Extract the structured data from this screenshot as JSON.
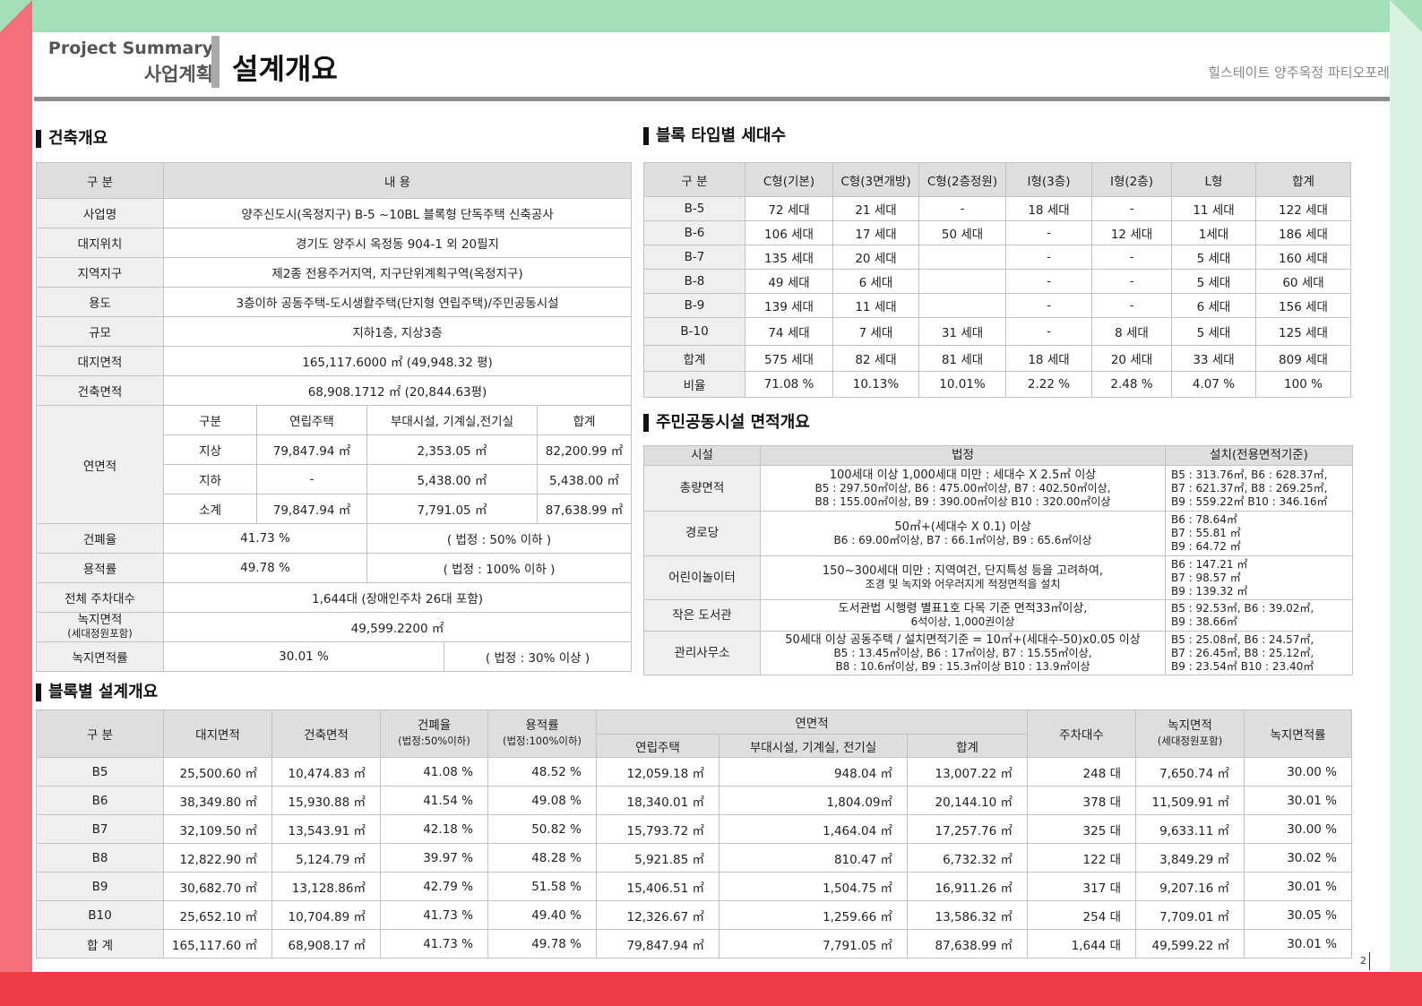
{
  "header": {
    "en": "Project Summary",
    "ko": "사업계획",
    "title": "설계개요",
    "right": "힐스테이트 양주옥정 파티오포레"
  },
  "page_number": "2",
  "building": {
    "title": "건축개요",
    "h_cat": "구 분",
    "h_content": "내      용",
    "rows": [
      {
        "label": "사업명",
        "value": "양주신도시(옥정지구) B-5 ~10BL 블록형 단독주택 신축공사"
      },
      {
        "label": "대지위치",
        "value": "경기도 양주시 옥정동 904-1 외 20필지"
      },
      {
        "label": "지역지구",
        "value": "제2종 전용주거지역, 지구단위계획구역(옥정지구)"
      },
      {
        "label": "용도",
        "value": "3층이하 공동주택-도시생활주택(단지형 연립주택)/주민공동시설"
      },
      {
        "label": "규모",
        "value": "지하1층, 지상3층"
      },
      {
        "label": "대지면적",
        "value": "165,117.6000 ㎡ (49,948.32 평)"
      },
      {
        "label": "건축면적",
        "value": "68,908.1712 ㎡ (20,844.63평)"
      }
    ],
    "floor": {
      "label": "연면적",
      "h": [
        "구분",
        "연립주택",
        "부대시설, 기계실,전기실",
        "합계"
      ],
      "rows": [
        [
          "지상",
          "79,847.94 ㎡",
          "2,353.05 ㎡",
          "82,200.99 ㎡"
        ],
        [
          "지하",
          "-",
          "5,438.00 ㎡",
          "5,438.00 ㎡"
        ],
        [
          "소계",
          "79,847.94 ㎡",
          "7,791.05 ㎡",
          "87,638.99 ㎡"
        ]
      ]
    },
    "coverage": {
      "label": "건폐율",
      "value": "41.73 %",
      "legal": "( 법정 : 50% 이하 )"
    },
    "far": {
      "label": "용적률",
      "value": "49.78 %",
      "legal": "( 법정 : 100% 이하 )"
    },
    "parking": {
      "label": "전체 주차대수",
      "value": "1,644대 (장애인주차 26대 포함)"
    },
    "green": {
      "label": "녹지면적",
      "sub": "(세대정원포함)",
      "value": "49,599.2200 ㎡"
    },
    "green_rate": {
      "label": "녹지면적률",
      "value": "30.01 %",
      "legal": "( 법정 : 30% 이상 )"
    }
  },
  "units": {
    "title": "블록 타입별 세대수",
    "headers": [
      "구 분",
      "C형(기본)",
      "C형(3면개방)",
      "C형(2층정원)",
      "I형(3층)",
      "I형(2층)",
      "L형",
      "합계"
    ],
    "rows": [
      [
        "B-5",
        "72 세대",
        "21 세대",
        "-",
        "18 세대",
        "-",
        "11 세대",
        "122 세대"
      ],
      [
        "B-6",
        "106 세대",
        "17 세대",
        "50 세대",
        "-",
        "12 세대",
        "1세대",
        "186 세대"
      ],
      [
        "B-7",
        "135 세대",
        "20 세대",
        "",
        "-",
        "-",
        "5 세대",
        "160 세대"
      ],
      [
        "B-8",
        "49 세대",
        "6 세대",
        "",
        "-",
        "-",
        "5 세대",
        "60 세대"
      ],
      [
        "B-9",
        "139 세대",
        "11 세대",
        "",
        "-",
        "-",
        "6 세대",
        "156 세대"
      ],
      [
        "B-10",
        "74 세대",
        "7 세대",
        "31 세대",
        "-",
        "8 세대",
        "5 세대",
        "125 세대"
      ],
      [
        "합계",
        "575 세대",
        "82 세대",
        "81 세대",
        "18 세대",
        "20 세대",
        "33 세대",
        "809 세대"
      ],
      [
        "비율",
        "71.08 %",
        "10.13%",
        "10.01%",
        "2.22 %",
        "2.48 %",
        "4.07 %",
        "100 %"
      ]
    ]
  },
  "facilities": {
    "title": "주민공동시설 면적개요",
    "headers": [
      "시설",
      "법정",
      "설치(전용면적기준)"
    ],
    "rows": [
      {
        "name": "총량면적",
        "legal": [
          "100세대 이상 1,000세대 미만 : 세대수 X 2.5㎡ 이상",
          "B5 : 297.50㎡이상,  B6 : 475.00㎡이상, B7 : 402.50㎡이상,",
          "B8 : 155.00㎡이상, B9 : 390.00㎡이상 B10 : 320.00㎡이상"
        ],
        "installed": [
          "B5 : 313.76㎡, B6 : 628.37㎡,",
          "B7 : 621.37㎡, B8 : 269.25㎡,",
          "B9 : 559.22㎡  B10 : 346.16㎡"
        ]
      },
      {
        "name": "경로당",
        "legal": [
          "50㎡+(세대수 X 0.1) 이상",
          "B6 : 69.00㎡이상,  B7 : 66.1㎡이상, B9 : 65.6㎡이상"
        ],
        "installed": [
          "B6 : 78.64㎡",
          "B7 : 55.81 ㎡",
          "B9 : 64.72 ㎡"
        ]
      },
      {
        "name": "어린이놀이터",
        "legal": [
          "150~300세대 미만 : 지역여건, 단지특성 등을 고려하여,",
          "조경 및 녹지와 어우러지게 적정면적을 설치"
        ],
        "installed": [
          "B6 : 147.21 ㎡",
          "B7 : 98.57 ㎡",
          "B9 : 139.32 ㎡"
        ]
      },
      {
        "name": "작은 도서관",
        "legal": [
          "도서관법 시행령 별표1호 다목 기준 면적33㎡이상,",
          "6석이상, 1,000권이상"
        ],
        "installed": [
          "B5 : 92.53㎡, B6 : 39.02㎡,",
          "B9 : 38.66㎡"
        ]
      },
      {
        "name": "관리사무소",
        "legal": [
          "50세대 이상 공동주택 / 설치면적기준 = 10㎡+(세대수-50)x0.05  이상",
          "B5 : 13.45㎡이상,  B6 : 17㎡이상, B7 : 15.55㎡이상,",
          "B8 : 10.6㎡이상, B9 : 15.3㎡이상 B10 : 13.9㎡이상"
        ],
        "installed": [
          "B5 : 25.08㎡,  B6 : 24.57㎡,",
          "B7 : 26.45㎡, B8 : 25.12㎡,",
          "B9 : 23.54㎡ B10 : 23.40㎡"
        ]
      }
    ]
  },
  "blocks": {
    "title": "블록별 설계개요",
    "h": {
      "cat": "구 분",
      "site": "대지면적",
      "bldg": "건축면적",
      "cov": "건폐율",
      "cov_sub": "(법정:50%이하)",
      "far": "용적률",
      "far_sub": "(법정:100%이하)",
      "gfa": "연면적",
      "gfa_res": "연립주택",
      "gfa_aux": "부대시설, 기계실, 전기실",
      "gfa_sum": "합계",
      "park": "주차대수",
      "green": "녹지면적",
      "green_sub": "(세대정원포함)",
      "green_rate": "녹지면적률"
    },
    "rows": [
      [
        "B5",
        "25,500.60 ㎡",
        "10,474.83 ㎡",
        "41.08 %",
        "48.52 %",
        "12,059.18 ㎡",
        "948.04 ㎡",
        "13,007.22 ㎡",
        "248 대",
        "7,650.74 ㎡",
        "30.00 %"
      ],
      [
        "B6",
        "38,349.80 ㎡",
        "15,930.88 ㎡",
        "41.54 %",
        "49.08 %",
        "18,340.01 ㎡",
        "1,804.09㎡",
        "20,144.10 ㎡",
        "378 대",
        "11,509.91 ㎡",
        "30.01 %"
      ],
      [
        "B7",
        "32,109.50 ㎡",
        "13,543.91 ㎡",
        "42.18 %",
        "50.82 %",
        "15,793.72 ㎡",
        "1,464.04 ㎡",
        "17,257.76 ㎡",
        "325 대",
        "9,633.11 ㎡",
        "30.00 %"
      ],
      [
        "B8",
        "12,822.90 ㎡",
        "5,124.79 ㎡",
        "39.97 %",
        "48.28 %",
        "5,921.85 ㎡",
        "810.47 ㎡",
        "6,732.32 ㎡",
        "122 대",
        "3,849.29 ㎡",
        "30.02 %"
      ],
      [
        "B9",
        "30,682.70 ㎡",
        "13,128.86㎡",
        "42.79 %",
        "51.58 %",
        "15,406.51 ㎡",
        "1,504.75 ㎡",
        "16,911.26 ㎡",
        "317 대",
        "9,207.16 ㎡",
        "30.01 %"
      ],
      [
        "B10",
        "25,652.10 ㎡",
        "10,704.89 ㎡",
        "41.73 %",
        "49.40 %",
        "12,326.67 ㎡",
        "1,259.66 ㎡",
        "13,586.32 ㎡",
        "254 대",
        "7,709.01 ㎡",
        "30.05 %"
      ],
      [
        "합 계",
        "165,117.60 ㎡",
        "68,908.17 ㎡",
        "41.73 %",
        "49.78 %",
        "79,847.94 ㎡",
        "7,791.05 ㎡",
        "87,638.99 ㎡",
        "1,644 대",
        "49,599.22 ㎡",
        "30.01 %"
      ]
    ]
  }
}
